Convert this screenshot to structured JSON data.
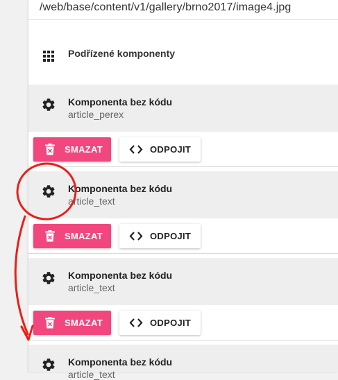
{
  "path": {
    "value": "/web/base/content/v1/gallery/brno2017/image4.jpg"
  },
  "section": {
    "title": "Podřízené komponenty",
    "icon": "grid-icon"
  },
  "components": [
    {
      "title": "Komponenta bez kódu",
      "code": "article_perex",
      "icon": "gear-icon"
    },
    {
      "title": "Komponenta bez kódu",
      "code": "article_text",
      "icon": "gear-icon"
    },
    {
      "title": "Komponenta bez kódu",
      "code": "article_text",
      "icon": "gear-icon"
    },
    {
      "title": "Komponenta bez kódu",
      "code": "article_text",
      "icon": "gear-icon"
    }
  ],
  "actions": {
    "delete_label": "SMAZAT",
    "detach_label": "ODPOJIT",
    "delete_icon": "trash-icon",
    "detach_icon": "code-icon"
  },
  "colors": {
    "delete": "#f2467e",
    "header_bg": "#eeeeee",
    "annotation": "#e8201a"
  }
}
